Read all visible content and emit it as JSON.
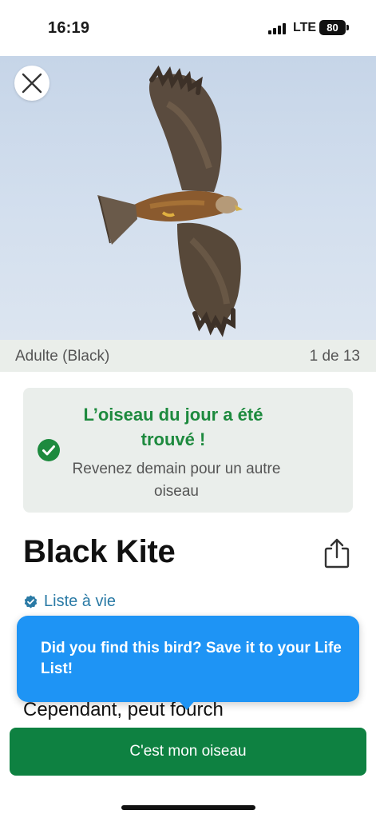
{
  "status_bar": {
    "time": "16:19",
    "network": "LTE",
    "battery": "80"
  },
  "hero": {
    "close_icon": "close-icon"
  },
  "caption": {
    "label": "Adulte (Black)",
    "counter": "1 de 13"
  },
  "found_card": {
    "title": "L’oiseau du jour a été trouvé !",
    "subtitle": "Revenez demain pour un autre oiseau",
    "icon": "check-circle-icon",
    "accent_color": "#1d8a3e"
  },
  "species": {
    "name": "Black Kite",
    "share_icon": "share-icon",
    "life_list_label": "Liste à vie",
    "life_list_icon": "verified-badge-icon"
  },
  "body_text": "plumage entièrement foncé. Cependant, peut fourch",
  "tooltip": {
    "text": "Did you find this bird? Save it to your Life List!",
    "color": "#1e94f5"
  },
  "cta": {
    "label": "C'est mon oiseau",
    "color": "#0e8141"
  }
}
